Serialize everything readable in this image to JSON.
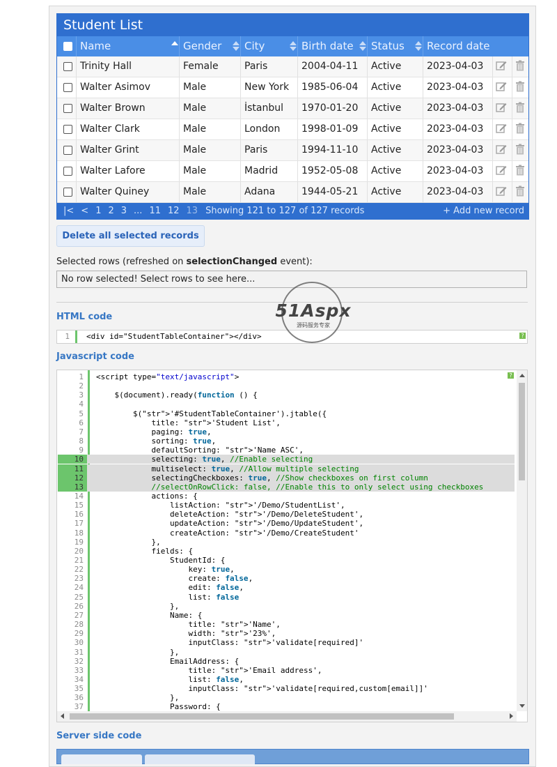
{
  "table": {
    "title": "Student List",
    "columns": [
      "Name",
      "Gender",
      "City",
      "Birth date",
      "Status",
      "Record date"
    ],
    "rows": [
      [
        "Trinity Hall",
        "Female",
        "Paris",
        "2004-04-11",
        "Active",
        "2023-04-03"
      ],
      [
        "Walter Asimov",
        "Male",
        "New York",
        "1985-06-04",
        "Active",
        "2023-04-03"
      ],
      [
        "Walter Brown",
        "Male",
        "İstanbul",
        "1970-01-20",
        "Active",
        "2023-04-03"
      ],
      [
        "Walter Clark",
        "Male",
        "London",
        "1998-01-09",
        "Active",
        "2023-04-03"
      ],
      [
        "Walter Grint",
        "Male",
        "Paris",
        "1994-11-10",
        "Active",
        "2023-04-03"
      ],
      [
        "Walter Lafore",
        "Male",
        "Madrid",
        "1952-05-08",
        "Active",
        "2023-04-03"
      ],
      [
        "Walter Quiney",
        "Male",
        "Adana",
        "1944-05-21",
        "Active",
        "2023-04-03"
      ]
    ],
    "pager": [
      "|<",
      "<",
      "1",
      "2",
      "3",
      "...",
      "11",
      "12",
      "13"
    ],
    "pager_current": "13",
    "info": "Showing 121 to 127 of 127 records",
    "add_label": "+ Add new record"
  },
  "delete_button": "Delete all selected records",
  "selected": {
    "label_prefix": "Selected rows (refreshed on ",
    "label_bold": "selectionChanged",
    "label_suffix": " event):",
    "box_text": "No row selected! Select rows to see here..."
  },
  "html_section": {
    "title": "HTML code",
    "line_no": "1",
    "code": "<div id=\"StudentTableContainer\"></div>"
  },
  "js_section": {
    "title": "Javascript code",
    "lines": [
      "<script type=\"text/javascript\">",
      "",
      "    $(document).ready(function () {",
      "",
      "        $('#StudentTableContainer').jtable({",
      "            title: 'Student List',",
      "            paging: true,",
      "            sorting: true,",
      "            defaultSorting: 'Name ASC',",
      "            selecting: true, //Enable selecting",
      "            multiselect: true, //Allow multiple selecting",
      "            selectingCheckboxes: true, //Show checkboxes on first column",
      "            //selectOnRowClick: false, //Enable this to only select using checkboxes",
      "            actions: {",
      "                listAction: '/Demo/StudentList',",
      "                deleteAction: '/Demo/DeleteStudent',",
      "                updateAction: '/Demo/UpdateStudent',",
      "                createAction: '/Demo/CreateStudent'",
      "            },",
      "            fields: {",
      "                StudentId: {",
      "                    key: true,",
      "                    create: false,",
      "                    edit: false,",
      "                    list: false",
      "                },",
      "                Name: {",
      "                    title: 'Name',",
      "                    width: '23%',",
      "                    inputClass: 'validate[required]'",
      "                },",
      "                EmailAddress: {",
      "                    title: 'Email address',",
      "                    list: false,",
      "                    inputClass: 'validate[required,custom[email]]'",
      "                },",
      "                Password: {"
    ],
    "highlighted_lines": [
      10,
      11,
      12,
      13
    ]
  },
  "server_section": {
    "title": "Server side code"
  },
  "watermark": {
    "logo": "51Aspx",
    "tagline": "源码服务专家"
  },
  "icons": {
    "help": "?",
    "edit": "edit-icon",
    "delete": "trash-icon"
  },
  "colors": {
    "header": "#2f6fcf",
    "header_row": "#4a8ee6",
    "section": "#3777c4",
    "gutter": "#6cc56c"
  }
}
